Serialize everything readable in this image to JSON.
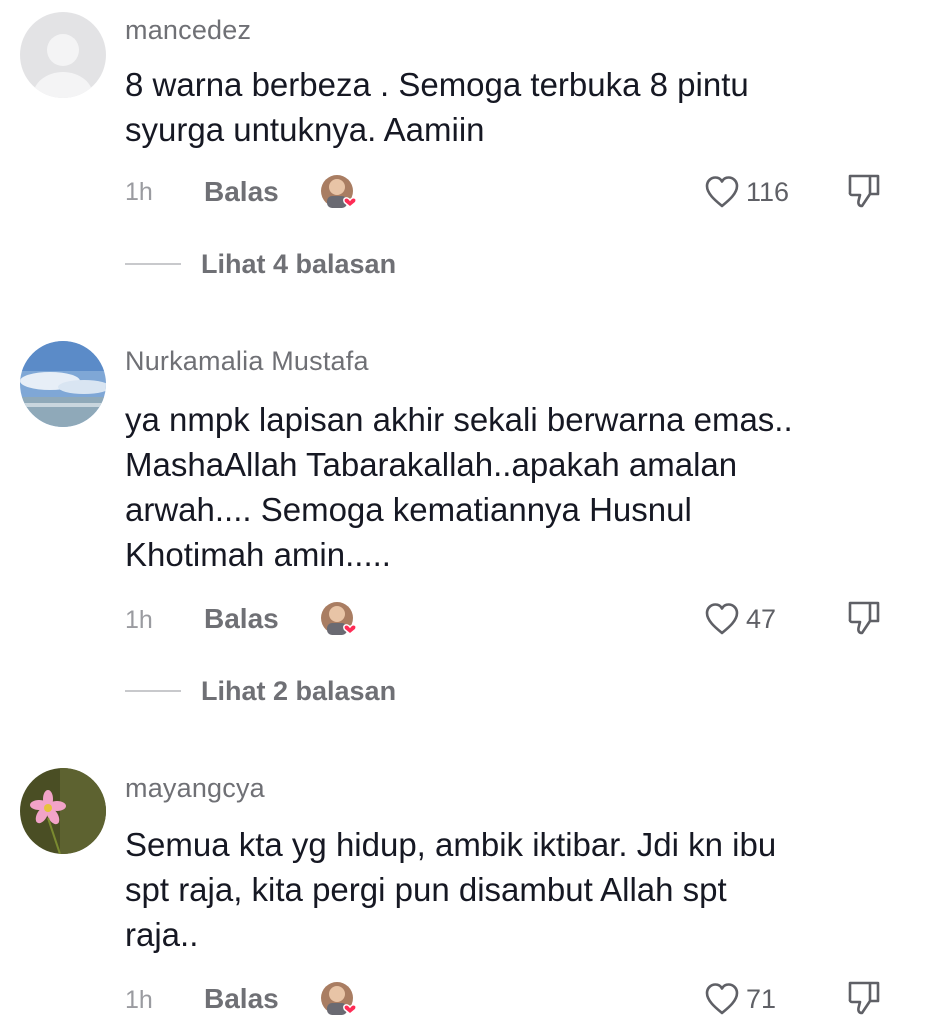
{
  "comments": [
    {
      "username": "mancedez",
      "text_lines": [
        "8 warna berbeza . Semoga terbuka 8 pintu",
        "syurga untuknya. Aamiin"
      ],
      "time": "1h",
      "reply_label": "Balas",
      "likes": "116",
      "view_replies": "Lihat 4 balasan",
      "avatar_icon": "default-profile-icon"
    },
    {
      "username": "Nurkamalia Mustafa",
      "text_lines": [
        "ya nmpk lapisan akhir sekali berwarna emas..",
        "MashaAllah Tabarakallah..apakah amalan",
        "arwah.... Semoga kematiannya Husnul",
        "Khotimah amin....."
      ],
      "time": "1h",
      "reply_label": "Balas",
      "likes": "47",
      "view_replies": "Lihat 2 balasan",
      "avatar_icon": "sky-sea-photo"
    },
    {
      "username": "mayangcya",
      "text_lines": [
        "Semua kta yg hidup, ambik iktibar. Jdi kn ibu",
        "spt raja, kita pergi pun disambut Allah spt",
        "raja.."
      ],
      "time": "1h",
      "reply_label": "Balas",
      "likes": "71",
      "avatar_icon": "pink-flower-photo"
    }
  ],
  "colors": {
    "heart": "#fe2c55",
    "text": "#161823",
    "secondary": "#6f7075"
  }
}
